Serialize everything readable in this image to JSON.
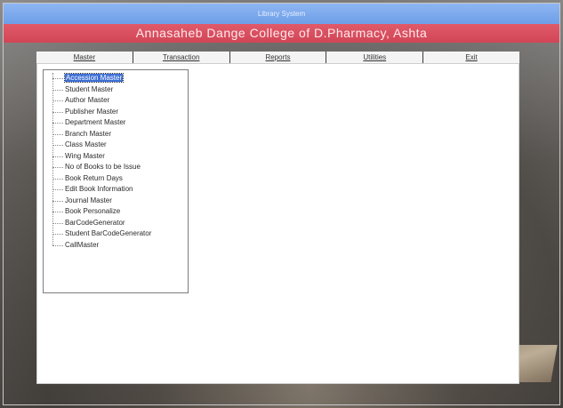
{
  "window": {
    "title": "Library System"
  },
  "banner": {
    "text": "Annasaheb Dange College of D.Pharmacy, Ashta"
  },
  "menu": {
    "items": [
      {
        "label": "Master"
      },
      {
        "label": "Transaction"
      },
      {
        "label": "Reports"
      },
      {
        "label": "Utilities"
      },
      {
        "label": "Exit"
      }
    ]
  },
  "master_menu": {
    "selected_index": 0,
    "items": [
      {
        "label": "Accession Master"
      },
      {
        "label": "Student Master"
      },
      {
        "label": "Author Master"
      },
      {
        "label": "Publisher Master"
      },
      {
        "label": "Department Master"
      },
      {
        "label": "Branch Master"
      },
      {
        "label": "Class Master"
      },
      {
        "label": "Wing Master"
      },
      {
        "label": "No of Books to be Issue"
      },
      {
        "label": "Book Return Days"
      },
      {
        "label": "Edit Book Information"
      },
      {
        "label": "Journal Master"
      },
      {
        "label": "Book Personalize"
      },
      {
        "label": "BarCodeGenerator"
      },
      {
        "label": "Student BarCodeGenerator"
      },
      {
        "label": "CallMaster"
      }
    ]
  },
  "colors": {
    "titlebar": "#7ea9ee",
    "banner": "#d9505f",
    "selection": "#3d6fd6"
  }
}
